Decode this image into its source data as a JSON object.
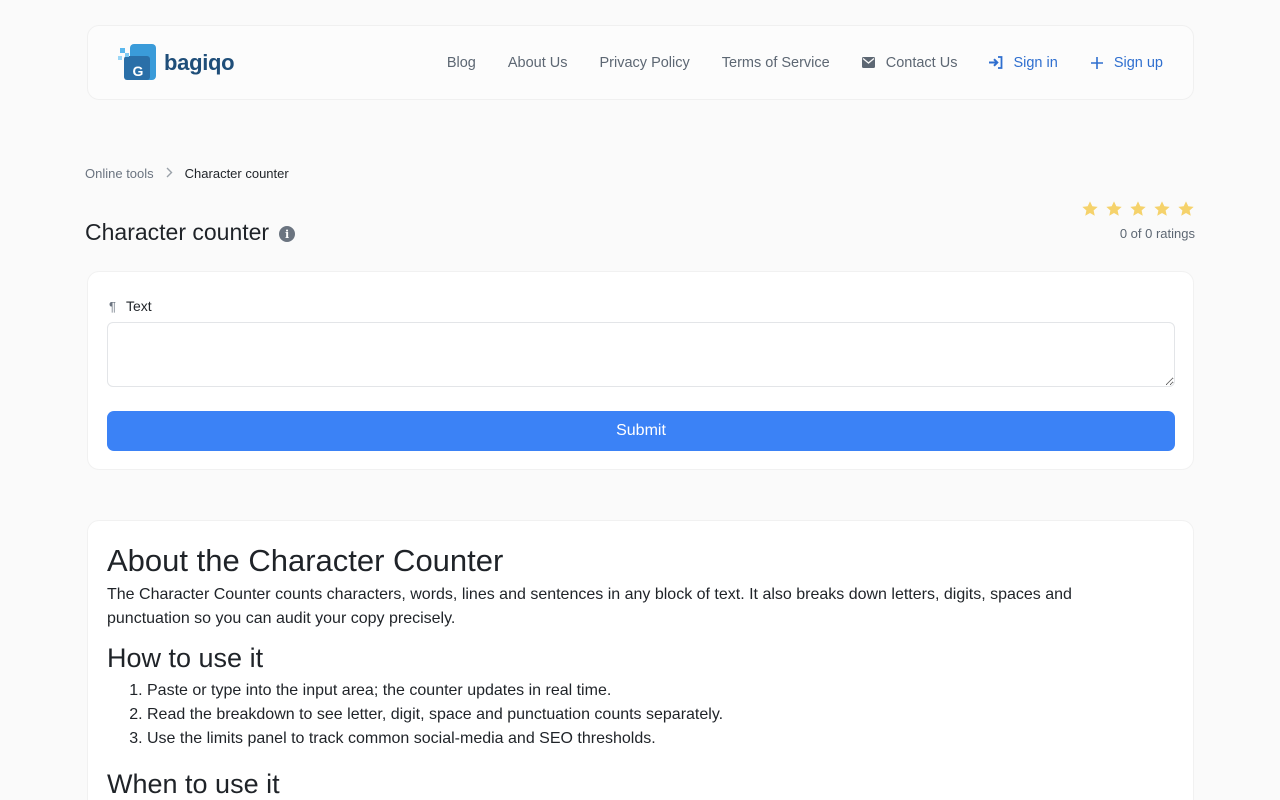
{
  "brand": {
    "name": "bagiqo"
  },
  "nav": {
    "items": [
      {
        "label": "Blog",
        "icon": ""
      },
      {
        "label": "About Us",
        "icon": ""
      },
      {
        "label": "Privacy Policy",
        "icon": ""
      },
      {
        "label": "Terms of Service",
        "icon": ""
      },
      {
        "label": "Contact Us",
        "icon": "envelope-icon"
      },
      {
        "label": "Sign in",
        "icon": "sign-in-icon"
      },
      {
        "label": "Sign up",
        "icon": "plus-icon"
      }
    ],
    "accent_color": "#2f6fcf"
  },
  "breadcrumb": {
    "parent": "Online tools",
    "current": "Character counter"
  },
  "page": {
    "title": "Character counter"
  },
  "rating": {
    "stars_total": 5,
    "text": "0 of 0 ratings",
    "star_color": "#f5d26b"
  },
  "tool": {
    "field_label": "Text",
    "field_value": "",
    "submit_label": "Submit",
    "submit_color": "#3b82f6"
  },
  "about": {
    "title": "About the Character Counter",
    "paragraph": "The Character Counter counts characters, words, lines and sentences in any block of text. It also breaks down letters, digits, spaces and punctuation so you can audit your copy precisely.",
    "howto_title": "How to use it",
    "steps": [
      "Paste or type into the input area; the counter updates in real time.",
      "Read the breakdown to see letter, digit, space and punctuation counts separately.",
      "Use the limits panel to track common social-media and SEO thresholds."
    ],
    "when_title": "When to use it"
  }
}
